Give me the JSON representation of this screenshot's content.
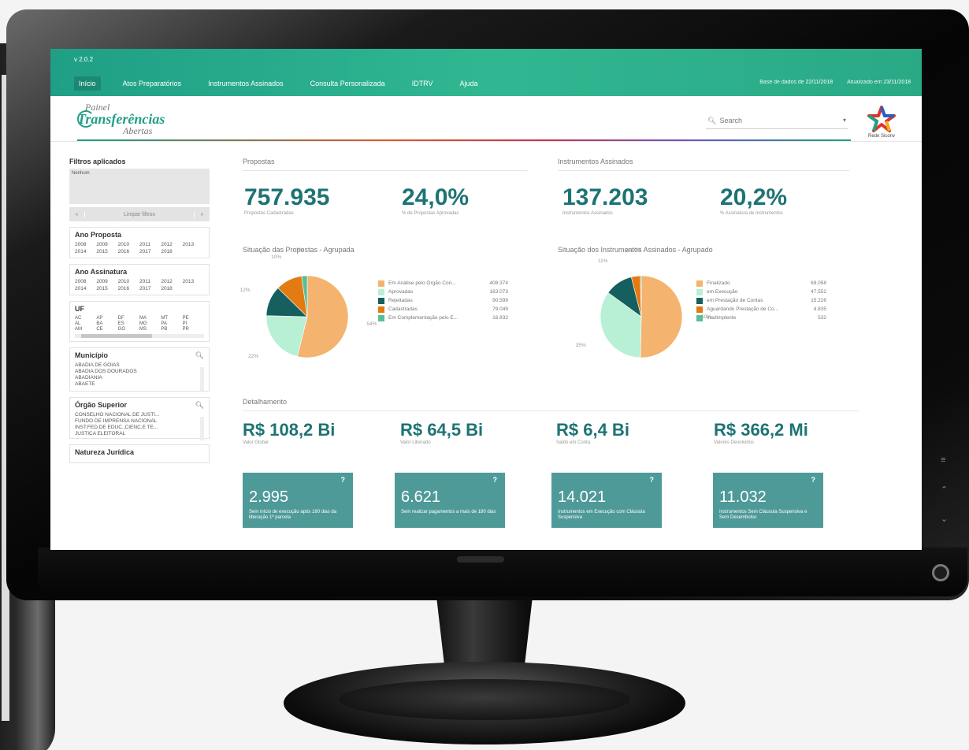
{
  "app": {
    "version": "v 2.0.2",
    "nav": [
      "Início",
      "Atos Preparatórios",
      "Instrumentos Assinados",
      "Consulta Personalizada",
      "IDTRV",
      "Ajuda"
    ],
    "base_label": "Base de dados de",
    "base_date": "22/11/2018",
    "updated_label": "Atualizado em",
    "updated_date": "23/11/2018"
  },
  "brand": {
    "line1": "Painel",
    "line2": "Transferências",
    "line3": "Abertas"
  },
  "search": {
    "placeholder": "Search"
  },
  "partner_logo": {
    "label": "Rede Siconv"
  },
  "sidebar": {
    "filtros": {
      "title": "Filtros aplicados",
      "value": "Nenhum",
      "clear_label": "Limpar filtros",
      "prev": "«",
      "next": "»"
    },
    "ano_proposta": {
      "title": "Ano Proposta",
      "years": [
        "2008",
        "2009",
        "2010",
        "2011",
        "2012",
        "2013",
        "2014",
        "2015",
        "2016",
        "2017",
        "2018"
      ]
    },
    "ano_assinatura": {
      "title": "Ano Assinatura",
      "years": [
        "2008",
        "2009",
        "2010",
        "2011",
        "2012",
        "2013",
        "2014",
        "2015",
        "2016",
        "2017",
        "2018"
      ]
    },
    "uf": {
      "title": "UF",
      "states": [
        "AC",
        "AP",
        "DF",
        "MA",
        "MT",
        "PE",
        "AL",
        "BA",
        "ES",
        "MG",
        "PA",
        "PI",
        "AM",
        "CE",
        "GO",
        "MS",
        "PB",
        "PR"
      ]
    },
    "municipio": {
      "title": "Município",
      "items": [
        "ABADIA DE GOIAS",
        "ABADIA DOS DOURADOS",
        "ABADIANIA",
        "ABAETE"
      ]
    },
    "orgao": {
      "title": "Órgão Superior",
      "items": [
        "CONSELHO NACIONAL DE JUSTI...",
        "FUNDO DE IMPRENSA NACIONAL",
        "INST.FED.DE EDUC.,CIENC.E TE...",
        "JUSTICA ELEITORAL"
      ]
    },
    "natureza": {
      "title": "Natureza Jurídica"
    }
  },
  "propostas": {
    "title": "Propostas",
    "kpi1_value": "757.935",
    "kpi1_label": "Propostas Cadastradas",
    "kpi2_value": "24,0%",
    "kpi2_label": "% de Propostas Aprovadas"
  },
  "instrumentos": {
    "title": "Instrumentos Assinados",
    "kpi1_value": "137.203",
    "kpi1_label": "Instrumentos Assinados",
    "kpi2_value": "20,2%",
    "kpi2_label": "% Assinatura de Instrumentos"
  },
  "detalhamento": {
    "title": "Detalhamento",
    "money": [
      {
        "value": "R$ 108,2 Bi",
        "label": "Valor Global"
      },
      {
        "value": "R$ 64,5 Bi",
        "label": "Valor Liberado"
      },
      {
        "value": "R$ 6,4 Bi",
        "label": "Saldo em Conta"
      },
      {
        "value": "R$ 366,2 Mi",
        "label": "Valores Devolvidos"
      }
    ],
    "cards": [
      {
        "value": "2.995",
        "label": "Sem início de execução após 180 dias da liberação 1ª parcela",
        "help": "?"
      },
      {
        "value": "6.621",
        "label": "Sem realizar pagamentos a mais de 180 dias",
        "help": "?"
      },
      {
        "value": "14.021",
        "label": "Instrumentos em Execução com Cláusula Suspensiva",
        "help": "?"
      },
      {
        "value": "11.032",
        "label": "Instrumentos Sem Cláusula Suspensiva e Sem Desembolso",
        "help": "?"
      }
    ]
  },
  "chart_data": [
    {
      "type": "pie",
      "title": "Situação das Propostas - Agrupada",
      "slices": [
        {
          "label": "Em Análise pelo Órgão Con...",
          "value": 408374,
          "display": "408.374",
          "pct_label": "54%",
          "color": "#f4b36f"
        },
        {
          "label": "Aprovadas",
          "value": 163073,
          "display": "163.073",
          "pct_label": "22%",
          "color": "#b8f0d6"
        },
        {
          "label": "Rejeitadas",
          "value": 90599,
          "display": "90.599",
          "pct_label": "12%",
          "color": "#15605f"
        },
        {
          "label": "Cadastradas",
          "value": 79049,
          "display": "79.049",
          "pct_label": "10%",
          "color": "#e37b12"
        },
        {
          "label": "Em Complementação pelo E...",
          "value": 16832,
          "display": "16.832",
          "pct_label": "2%",
          "color": "#57bf9a"
        }
      ]
    },
    {
      "type": "pie",
      "title": "Situação dos Instrumentos Assinados - Agrupado",
      "slices": [
        {
          "label": "Finalizado",
          "value": 69058,
          "display": "69.058",
          "pct_label": "50%",
          "color": "#f4b36f"
        },
        {
          "label": "em Execução",
          "value": 47552,
          "display": "47.552",
          "pct_label": "35%",
          "color": "#b8f0d6"
        },
        {
          "label": "em Prestação de Contas",
          "value": 15226,
          "display": "15.226",
          "pct_label": "11%",
          "color": "#15605f"
        },
        {
          "label": "Aguardando Prestação de Co...",
          "value": 4835,
          "display": "4.835",
          "pct_label": "4%",
          "color": "#e37b12"
        },
        {
          "label": "Inadimplente",
          "value": 532,
          "display": "532",
          "pct_label": "0%",
          "color": "#57bf9a"
        }
      ]
    }
  ]
}
